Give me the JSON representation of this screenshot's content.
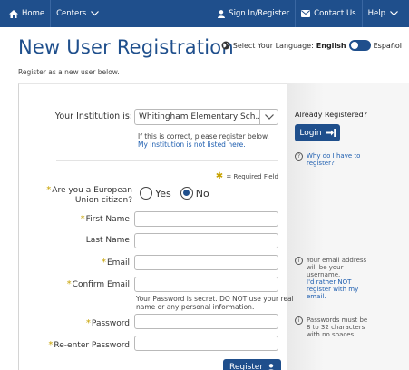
{
  "nav": {
    "home": "Home",
    "centers": "Centers",
    "sign_in": "Sign In/Register",
    "contact": "Contact Us",
    "help": "Help"
  },
  "header": {
    "title": "New User Registration",
    "subtitle": "Register as a new user below."
  },
  "language": {
    "label": "Select Your Language:",
    "english": "English",
    "spanish": "Español"
  },
  "institution": {
    "label": "Your Institution is:",
    "value": "Whitingham Elementary Sch...",
    "note": "If this is correct, please register below.",
    "not_listed": "My institution is not listed here."
  },
  "required_legend": "= Required Field",
  "eu": {
    "label_line1": "Are you a European",
    "label_line2": "Union citizen?",
    "yes": "Yes",
    "no": "No"
  },
  "fields": {
    "first_name": "First Name:",
    "last_name": "Last Name:",
    "email": "Email:",
    "confirm_email": "Confirm Email:",
    "password": "Password:",
    "reenter_password": "Re-enter Password:"
  },
  "password_note_line1": "Your Password is secret. DO NOT use your real",
  "password_note_line2": "name or any personal information.",
  "register_button": "Register",
  "side": {
    "already_registered": "Already Registered?",
    "login_button": "Login",
    "why_register_1": "Why do I have to",
    "why_register_2": "register?",
    "email_help_1": "Your email address",
    "email_help_2": "will be your",
    "email_help_3": "username.",
    "email_help_4": "I'd rather NOT",
    "email_help_5": "register with my",
    "email_help_6": "email.",
    "password_help_1": "Passwords must be",
    "password_help_2": "8 to 32 characters",
    "password_help_3": "with no spaces."
  },
  "colors": {
    "nav_bg": "#1f4f8c",
    "primary": "#1f4f8c",
    "required_star": "#c7a200",
    "link": "#1f5fb0"
  }
}
